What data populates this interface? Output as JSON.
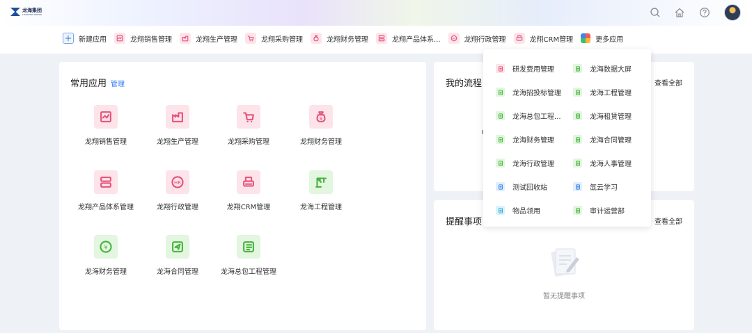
{
  "topbar": {
    "logo_text": "龙海集团",
    "logo_sub": "LONGHAI GROUP",
    "icons": [
      "search-icon",
      "home-icon",
      "help-icon"
    ]
  },
  "appbar": {
    "tabs": [
      {
        "label": "新建应用",
        "icon": "plus-icon",
        "style": "plus"
      },
      {
        "label": "龙翔销售管理",
        "icon": "sales-icon",
        "style": "pink"
      },
      {
        "label": "龙翔生产管理",
        "icon": "production-icon",
        "style": "pink"
      },
      {
        "label": "龙翔采购管理",
        "icon": "purchase-icon",
        "style": "pink"
      },
      {
        "label": "龙翔财务管理",
        "icon": "finance-icon",
        "style": "pink"
      },
      {
        "label": "龙翔产品体系...",
        "icon": "product-icon",
        "style": "pink"
      },
      {
        "label": "龙翔行政管理",
        "icon": "admin-icon",
        "style": "pink"
      },
      {
        "label": "龙翔CRM管理",
        "icon": "crm-icon",
        "style": "pink"
      },
      {
        "label": "更多应用",
        "icon": "more-apps-icon",
        "style": "multi"
      }
    ]
  },
  "common": {
    "title": "常用应用",
    "manage": "管理",
    "apps": [
      {
        "label": "龙翔销售管理",
        "icon": "sales-icon",
        "color": "pink"
      },
      {
        "label": "龙翔生产管理",
        "icon": "production-icon",
        "color": "pink"
      },
      {
        "label": "龙翔采购管理",
        "icon": "purchase-icon",
        "color": "pink"
      },
      {
        "label": "龙翔财务管理",
        "icon": "money-bag-icon",
        "color": "pink"
      },
      {
        "label": "龙翔产品体系管理",
        "icon": "server-icon",
        "color": "pink"
      },
      {
        "label": "龙翔行政管理",
        "icon": "hr-icon",
        "color": "pink"
      },
      {
        "label": "龙翔CRM管理",
        "icon": "printer-icon",
        "color": "pink"
      },
      {
        "label": "龙海工程管理",
        "icon": "crane-icon",
        "color": "green"
      },
      {
        "label": "龙海财务管理",
        "icon": "yuan-coin-icon",
        "color": "green"
      },
      {
        "label": "龙海合同管理",
        "icon": "send-icon",
        "color": "green"
      },
      {
        "label": "龙海总包工程管理",
        "icon": "checklist-icon",
        "color": "green"
      }
    ]
  },
  "flow": {
    "title": "我的流程",
    "viewall": "查看全部"
  },
  "remind": {
    "title": "提醒事项",
    "viewall": "查看全部",
    "empty": "暂无提醒事项"
  },
  "dropdown": {
    "items": [
      {
        "label": "研发费用管理",
        "color": "pink"
      },
      {
        "label": "龙海数据大屏",
        "color": "green"
      },
      {
        "label": "龙海招投标管理",
        "color": "green"
      },
      {
        "label": "龙海工程管理",
        "color": "green"
      },
      {
        "label": "龙海总包工程...",
        "color": "green"
      },
      {
        "label": "龙海租赁管理",
        "color": "green"
      },
      {
        "label": "龙海财务管理",
        "color": "green"
      },
      {
        "label": "龙海合同管理",
        "color": "green"
      },
      {
        "label": "龙海行政管理",
        "color": "green"
      },
      {
        "label": "龙海人事管理",
        "color": "green"
      },
      {
        "label": "测试回收站",
        "color": "blue"
      },
      {
        "label": "氙云学习",
        "color": "blue"
      },
      {
        "label": "物品领用",
        "color": "cyan"
      },
      {
        "label": "审计运营部",
        "color": "green"
      }
    ]
  }
}
